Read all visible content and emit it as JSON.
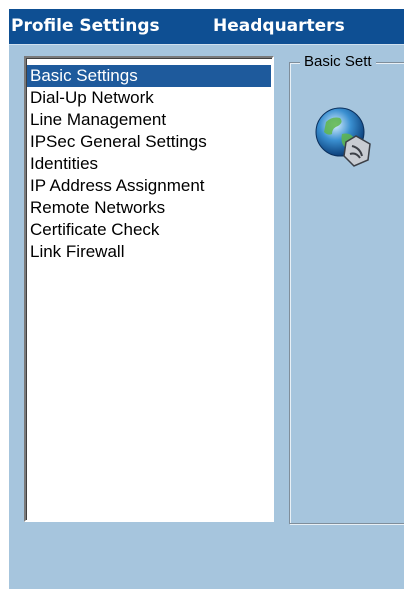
{
  "header": {
    "title_left": "Profile Settings",
    "title_right": "Headquarters"
  },
  "sidebar": {
    "items": [
      {
        "label": "Basic Settings",
        "selected": true
      },
      {
        "label": "Dial-Up Network",
        "selected": false
      },
      {
        "label": "Line Management",
        "selected": false
      },
      {
        "label": "IPSec General Settings",
        "selected": false
      },
      {
        "label": "Identities",
        "selected": false
      },
      {
        "label": "IP Address Assignment",
        "selected": false
      },
      {
        "label": "Remote Networks",
        "selected": false
      },
      {
        "label": "Certificate Check",
        "selected": false
      },
      {
        "label": "Link Firewall",
        "selected": false
      }
    ]
  },
  "content": {
    "group_label": "Basic Sett",
    "icon": "globe-network-icon"
  },
  "colors": {
    "titlebar": "#0e4f93",
    "panel": "#a6c5dd",
    "selection": "#1e5a9c"
  }
}
